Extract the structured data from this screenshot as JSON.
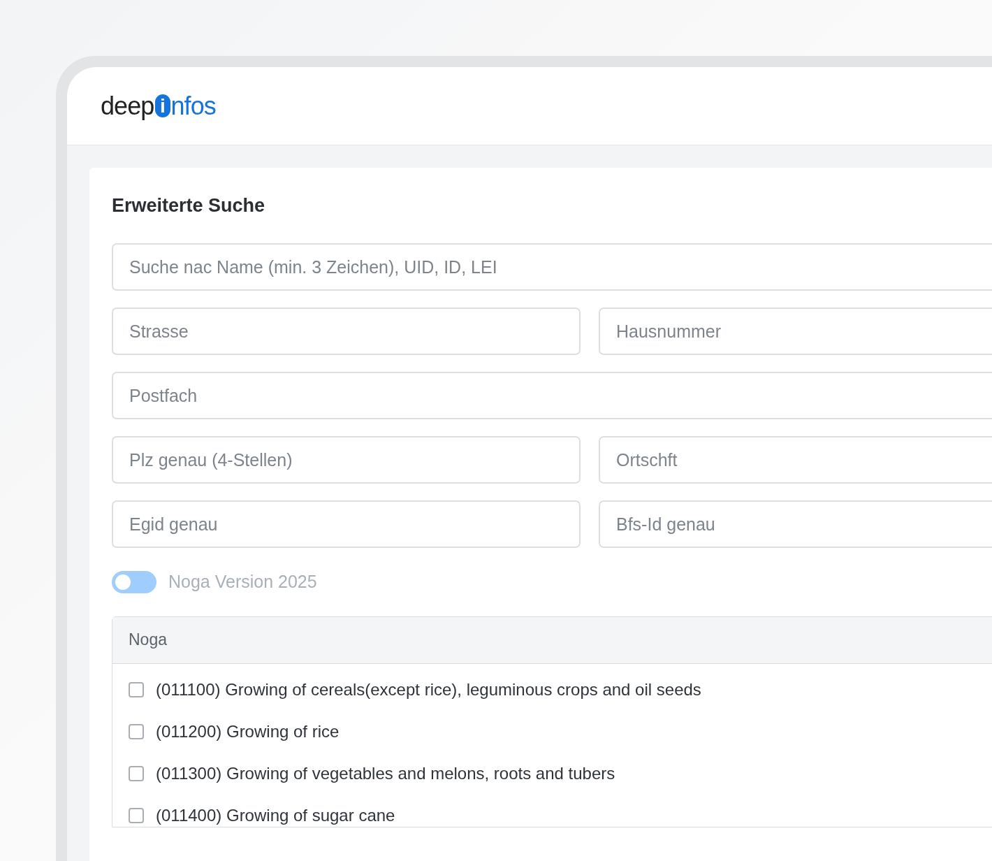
{
  "header": {
    "logo": {
      "part_1": "deep",
      "part_2": "i",
      "part_3": "nfos"
    }
  },
  "search_card": {
    "title": "Erweiterte Suche",
    "field_rows": [
      [
        {
          "placeholder": "Suche nac Name (min. 3 Zeichen), UID, ID, LEI"
        }
      ],
      [
        {
          "placeholder": "Strasse"
        },
        {
          "placeholder": "Hausnummer"
        }
      ],
      [
        {
          "placeholder": "Postfach"
        }
      ],
      [
        {
          "placeholder": "Plz genau (4-Stellen)"
        },
        {
          "placeholder": "Ortschft"
        }
      ],
      [
        {
          "placeholder": "Egid genau"
        },
        {
          "placeholder": "Bfs-Id genau"
        }
      ]
    ],
    "noga_toggle": {
      "label": "Noga Version 2025",
      "on": false
    },
    "noga_panel": {
      "title": "Noga",
      "items": [
        {
          "label": "(011100) Growing of cereals(except rice), leguminous crops and oil seeds",
          "checked": false
        },
        {
          "label": "(011200) Growing of rice",
          "checked": false
        },
        {
          "label": "(011300) Growing of vegetables and melons, roots and tubers",
          "checked": false
        },
        {
          "label": "(011400) Growing of sugar cane",
          "checked": false
        }
      ]
    }
  }
}
